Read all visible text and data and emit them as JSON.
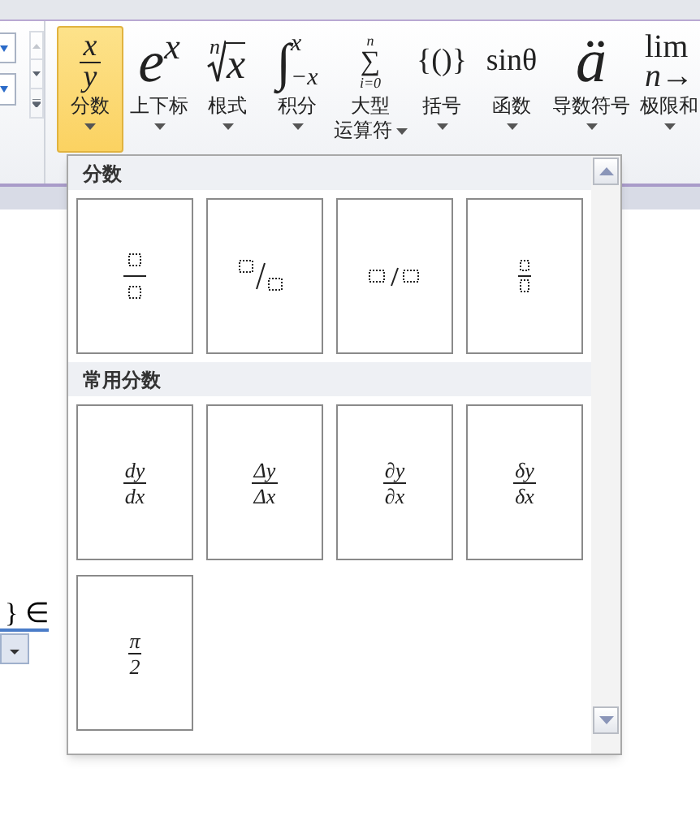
{
  "ribbon": {
    "tools": [
      {
        "label_lines": [
          "分数"
        ],
        "symbol": {
          "kind": "fraction",
          "top": "x",
          "bottom": "y"
        },
        "selected": true
      },
      {
        "label_lines": [
          "上下标"
        ],
        "symbol": {
          "kind": "script",
          "base": "e",
          "sup": "x"
        },
        "selected": false
      },
      {
        "label_lines": [
          "根式"
        ],
        "symbol": {
          "kind": "radical",
          "index": "n",
          "radicand": "x"
        },
        "selected": false
      },
      {
        "label_lines": [
          "积分"
        ],
        "symbol": {
          "kind": "bounds",
          "sign": "∫",
          "upper": "x",
          "lower": "−x"
        },
        "selected": false
      },
      {
        "label_lines": [
          "大型",
          "运算符"
        ],
        "symbol": {
          "kind": "stacked",
          "sign": "∑",
          "upper": "n",
          "lower": "i=0"
        },
        "selected": false
      },
      {
        "label_lines": [
          "括号"
        ],
        "symbol": {
          "kind": "plain",
          "text": "{()}"
        },
        "selected": false
      },
      {
        "label_lines": [
          "函数"
        ],
        "symbol": {
          "kind": "plain",
          "text": "sinθ"
        },
        "selected": false
      },
      {
        "label_lines": [
          "导数符号"
        ],
        "symbol": {
          "kind": "accent",
          "text": "ä"
        },
        "selected": false
      },
      {
        "label_lines": [
          "极限和"
        ],
        "symbol": {
          "kind": "limit",
          "top": "lim",
          "bottom": "n→"
        },
        "selected": false
      }
    ]
  },
  "document": {
    "text": "} ∈"
  },
  "gallery": {
    "sections": [
      {
        "title": "分数",
        "items": [
          {
            "kind": "stacked_box"
          },
          {
            "kind": "skewed_box"
          },
          {
            "kind": "linear_box"
          },
          {
            "kind": "small_box"
          }
        ]
      },
      {
        "title": "常用分数",
        "items": [
          {
            "kind": "text",
            "numerator": "dy",
            "denominator": "dx"
          },
          {
            "kind": "text",
            "numerator": "Δy",
            "denominator": "Δx"
          },
          {
            "kind": "text",
            "numerator": "∂y",
            "denominator": "∂x"
          },
          {
            "kind": "text",
            "numerator": "δy",
            "denominator": "δx"
          },
          {
            "kind": "text",
            "numerator": "π",
            "denominator": "2"
          }
        ]
      }
    ]
  }
}
